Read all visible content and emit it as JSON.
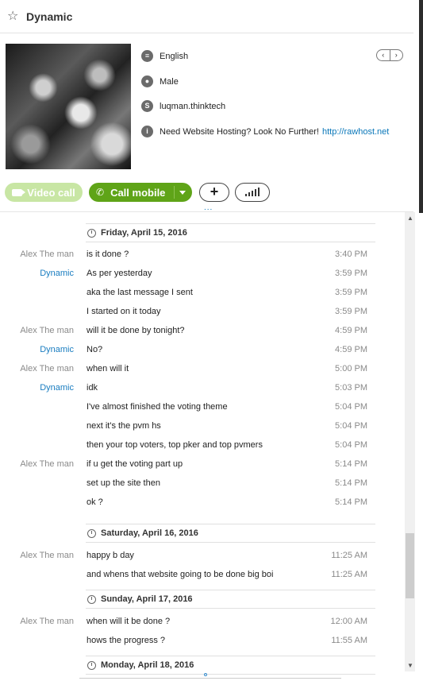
{
  "header": {
    "title": "Dynamic",
    "star_icon": "star-icon"
  },
  "profile": {
    "language": "English",
    "gender": "Male",
    "skype_name": "luqman.thinktech",
    "mood_text": "Need Website Hosting? Look No Further!",
    "mood_link": "http://rawhost.net"
  },
  "actions": {
    "video_call": "Video call",
    "call_mobile": "Call mobile",
    "add": "+",
    "more": "..."
  },
  "colors": {
    "accent_green": "#5fa418",
    "link_blue": "#0a77b9",
    "dynamic_name": "#1a7dc0"
  },
  "chat": {
    "dates": [
      "Friday, April 15, 2016",
      "Saturday, April 16, 2016",
      "Sunday, April 17, 2016",
      "Monday, April 18, 2016"
    ],
    "messages": [
      {
        "sender": "Alex The man",
        "text": "is it done ?",
        "time": "3:40 PM"
      },
      {
        "sender": "Dynamic",
        "text": "As per yesterday",
        "time": "3:59 PM"
      },
      {
        "sender": "",
        "text": "aka the last message I sent",
        "time": "3:59 PM"
      },
      {
        "sender": "",
        "text": "I started on it today",
        "time": "3:59 PM"
      },
      {
        "sender": "Alex The man",
        "text": "will it be done by tonight?",
        "time": "4:59 PM"
      },
      {
        "sender": "Dynamic",
        "text": "No?",
        "time": "4:59 PM"
      },
      {
        "sender": "Alex The man",
        "text": "when will it",
        "time": "5:00 PM"
      },
      {
        "sender": "Dynamic",
        "text": "idk",
        "time": "5:03 PM"
      },
      {
        "sender": "",
        "text": "I've almost finished the voting theme",
        "time": "5:04 PM"
      },
      {
        "sender": "",
        "text": "next it's the pvm hs",
        "time": "5:04 PM"
      },
      {
        "sender": "",
        "text": "then your top voters, top pker and top pvmers",
        "time": "5:04 PM"
      },
      {
        "sender": "Alex The man",
        "text": "if u get the voting part up",
        "time": "5:14 PM"
      },
      {
        "sender": "",
        "text": "set up the site then",
        "time": "5:14 PM"
      },
      {
        "sender": "",
        "text": "ok ?",
        "time": "5:14 PM"
      },
      {
        "sender": "Alex The man",
        "text": "happy b day",
        "time": "11:25 AM"
      },
      {
        "sender": "",
        "text": "and whens that website going to be done big boi",
        "time": "11:25 AM"
      },
      {
        "sender": "Alex The man",
        "text": "when will it be done ?",
        "time": "12:00 AM"
      },
      {
        "sender": "",
        "text": "hows the progress ?",
        "time": "11:55 AM"
      }
    ]
  }
}
